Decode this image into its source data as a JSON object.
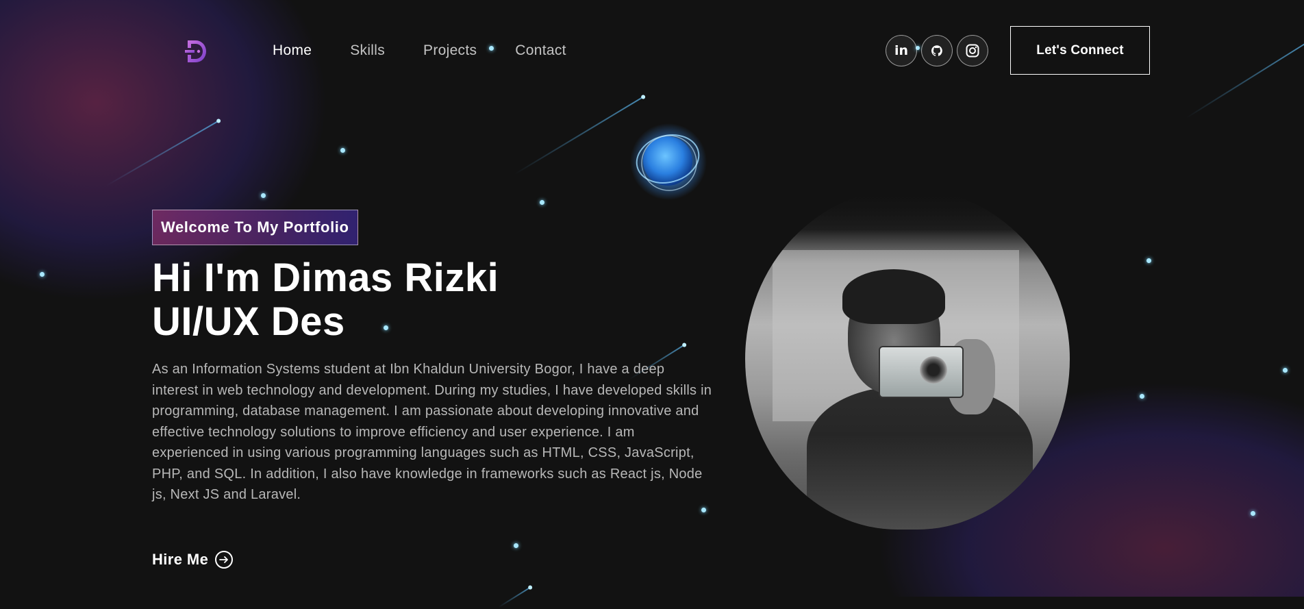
{
  "nav": {
    "logo": "D",
    "links": [
      {
        "label": "Home",
        "active": true
      },
      {
        "label": "Skills",
        "active": false
      },
      {
        "label": "Projects",
        "active": false
      },
      {
        "label": "Contact",
        "active": false
      }
    ],
    "social": [
      {
        "icon": "linkedin-icon",
        "label": "in"
      },
      {
        "icon": "github-icon"
      },
      {
        "icon": "instagram-icon"
      }
    ],
    "connect_label": "Let's Connect"
  },
  "hero": {
    "tagline": "Welcome To My Portfolio",
    "headline_line1": "Hi I'm Dimas Rizki",
    "headline_line2": "UI/UX Des",
    "bio": "As an Information Systems student at Ibn Khaldun University Bogor, I have a deep interest in web technology and development. During my studies, I have developed skills in programming, database management. I am passionate about developing innovative and effective technology solutions to improve efficiency and user experience. I am experienced in using various programming languages such as HTML, CSS, JavaScript, PHP, and SQL. In addition, I also have knowledge in frameworks such as React js, Node js, Next JS and Laravel.",
    "cta_label": "Hire Me",
    "cta_icon": "arrow-right-circle-icon"
  },
  "colors": {
    "background": "#121212",
    "gradient_start": "#AA367C",
    "gradient_end": "#4A2FBD",
    "star": "#a9e8ff"
  }
}
